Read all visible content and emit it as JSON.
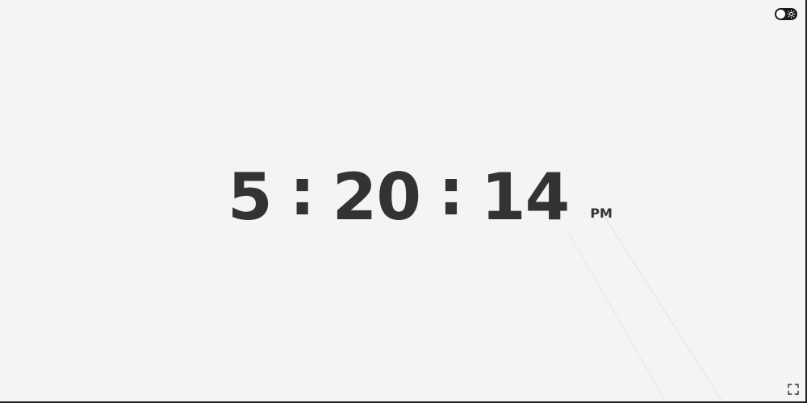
{
  "clock": {
    "hours": "5",
    "separator": ":",
    "minutes": "20",
    "seconds": "14",
    "period": "PM"
  },
  "controls": {
    "theme_toggle_icon": "sun-icon",
    "fullscreen_icon": "fullscreen-icon"
  },
  "colors": {
    "background": "#f4f4f4",
    "text": "#333333",
    "toggle": "#1a1a1a"
  }
}
